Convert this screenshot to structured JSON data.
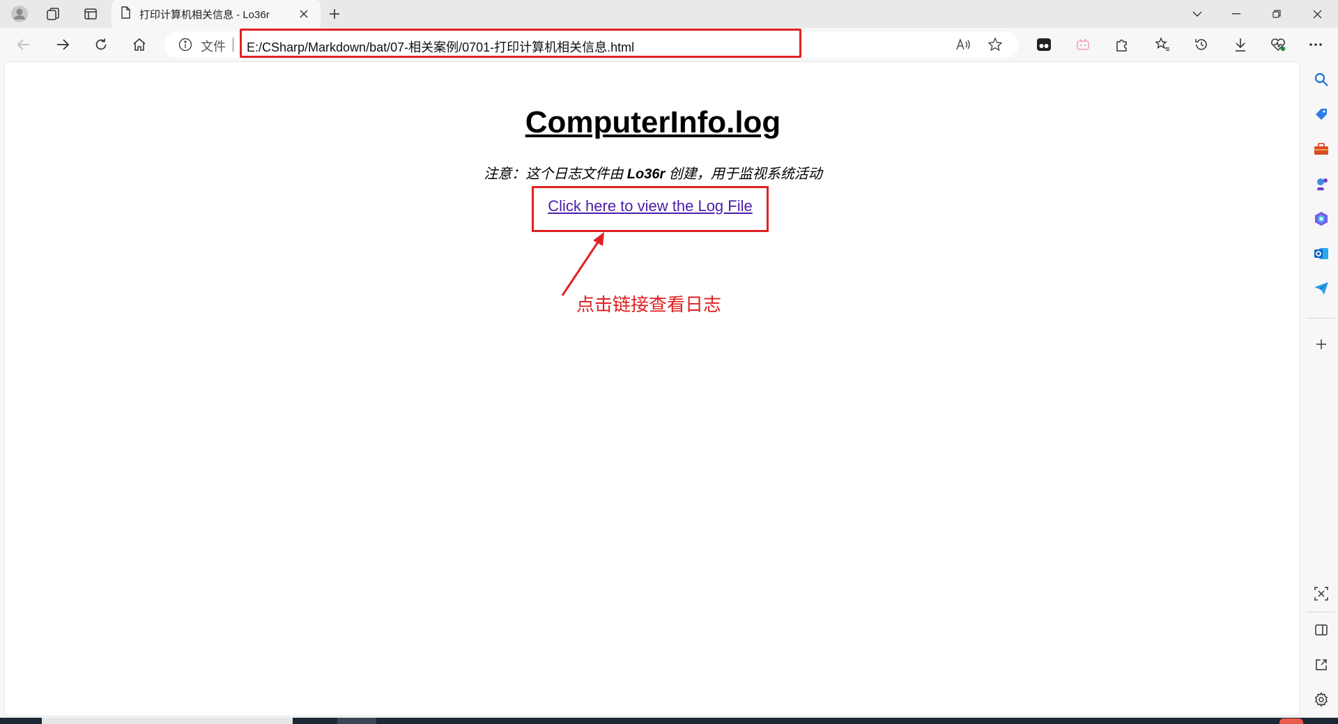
{
  "window": {
    "tab_title": "打印计算机相关信息 - Lo36r"
  },
  "toolbar": {
    "file_label": "文件",
    "url": "E:/CSharp/Markdown/bat/07-相关案例/0701-打印计算机相关信息.html"
  },
  "page": {
    "title": "ComputerInfo.log",
    "note_prefix": "注意：这个日志文件由 ",
    "note_author": "Lo36r",
    "note_suffix": " 创建，用于监视系统活动",
    "link_text": "Click here to view the Log File",
    "annotation": "点击链接查看日志"
  },
  "icons": {
    "tab_strip": [
      "profile-icon",
      "collections-icon",
      "vertical-tabs-icon",
      "page-icon",
      "close-icon",
      "new-tab-icon",
      "tab-search-icon",
      "minimize-icon",
      "restore-icon",
      "close-window-icon"
    ],
    "toolbar": [
      "back-icon",
      "forward-icon",
      "refresh-icon",
      "home-icon",
      "info-icon",
      "read-aloud-icon",
      "favorite-star-icon",
      "extension-icon",
      "extensions-icon",
      "favorites-icon",
      "history-icon",
      "downloads-icon",
      "browser-essentials-icon",
      "more-icon"
    ],
    "sidebar": [
      "search-icon",
      "shopping-icon",
      "tools-icon",
      "games-icon",
      "copilot-icon",
      "outlook-icon",
      "send-icon",
      "add-icon",
      "screenshot-icon",
      "split-screen-icon",
      "open-external-icon",
      "settings-icon"
    ]
  },
  "colors": {
    "annotation_red": "#e02020",
    "link_purple": "#4b1da8",
    "chrome_bg": "#f7f7f7"
  }
}
